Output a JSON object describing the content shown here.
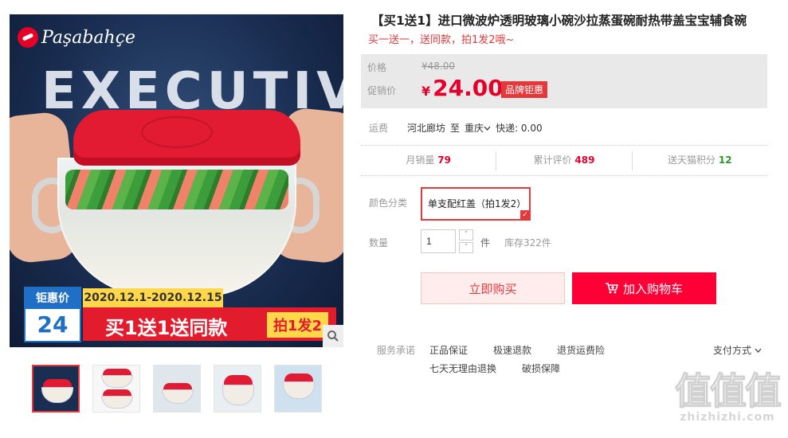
{
  "main_image": {
    "logo_text": "Paşabahçe",
    "shirt_text": "EXECUTIVE",
    "shirt_sub": "",
    "tag_label": "钜惠价",
    "tag_number": "24",
    "date_range": "2020.12.1-2020.12.15",
    "promo_text": "买1送1送同款",
    "promo_badge": "拍1发2"
  },
  "product": {
    "title": "【买1送1】进口微波炉透明玻璃小碗沙拉蒸蛋碗耐热带盖宝宝辅食碗",
    "subtitle": "买一送一，送同款，拍1发2哦~"
  },
  "price": {
    "original_label": "价格",
    "original_value": "¥48.00",
    "promo_label": "促销价",
    "currency": "¥",
    "promo_value": "24.00",
    "badge": "品牌钜惠"
  },
  "shipping": {
    "label": "运费",
    "from": "河北廊坊",
    "to_word": "至",
    "to": "重庆",
    "express": "快递: 0.00"
  },
  "stats": [
    {
      "label": "月销量",
      "value": "79",
      "color": "red"
    },
    {
      "label": "累计评价",
      "value": "489",
      "color": "red"
    },
    {
      "label": "送天猫积分",
      "value": "12",
      "color": "green"
    }
  ],
  "options": {
    "color_label": "颜色分类",
    "color_value": "单支配红盖（拍1发2）"
  },
  "quantity": {
    "label": "数量",
    "value": "1",
    "up": "˄",
    "down": "˅",
    "unit": "件",
    "stock": "库存322件"
  },
  "actions": {
    "buy": "立即购买",
    "cart": "加入购物车"
  },
  "services": {
    "label": "服务承诺",
    "items": [
      "正品保证",
      "极速退款",
      "退货运费险",
      "七天无理由退换",
      "破损保障"
    ],
    "pay": "支付方式"
  },
  "watermark": {
    "chars": "值值值",
    "url": "zhizhizhi.com"
  },
  "colors": {
    "accent": "#e4393c",
    "cart_bg": "#ff0036",
    "price_red": "#e4002b"
  }
}
